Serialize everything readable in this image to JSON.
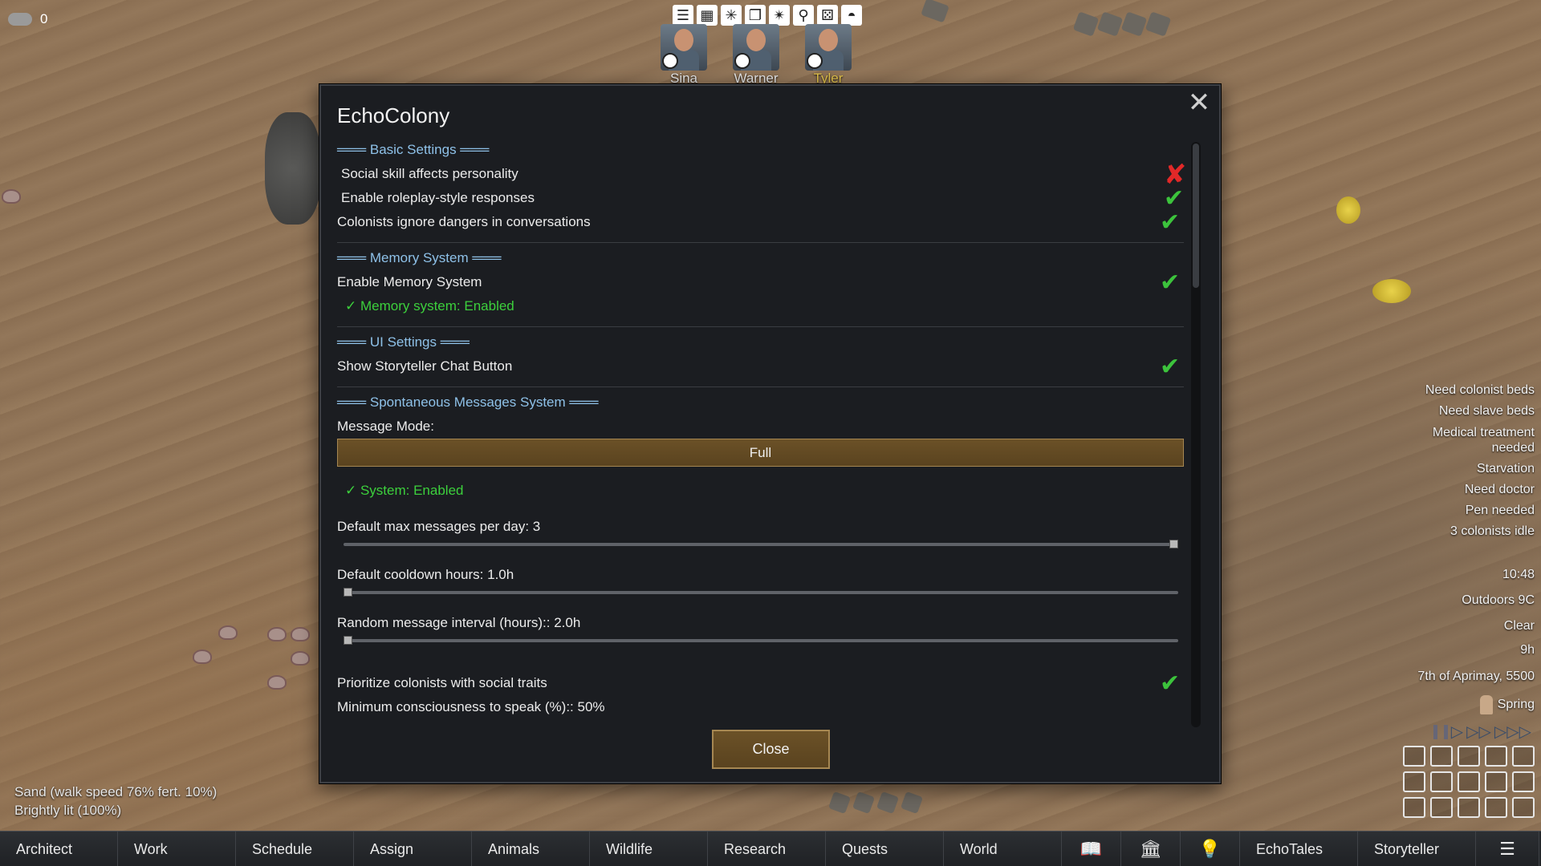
{
  "resource": {
    "count": "0",
    "icon": "cloud-icon"
  },
  "top_toolbar": {
    "icons": [
      "list-icon",
      "grid-icon",
      "sparkle-icon",
      "copy-icon",
      "sparkle-play-icon",
      "magnifier-icon",
      "dice-icon",
      "mask-icon"
    ]
  },
  "colonists": [
    {
      "name": "Sina",
      "selected": false
    },
    {
      "name": "Warner",
      "selected": false
    },
    {
      "name": "Tyler",
      "selected": true
    }
  ],
  "dialog": {
    "title": "EchoColony",
    "close_icon": "close-icon",
    "sections": {
      "basic": "═══ Basic Settings ═══",
      "memory": "═══ Memory System ═══",
      "ui": "═══ UI Settings ═══",
      "spontaneous": "═══ Spontaneous Messages System ═══"
    },
    "basic": {
      "social_skill": "Social skill affects personality",
      "roleplay": "Enable roleplay-style responses",
      "ignore_dangers": "Colonists ignore dangers in conversations"
    },
    "memory": {
      "enable": "Enable Memory System",
      "status": "✓ Memory system: Enabled"
    },
    "ui": {
      "storyteller_button": "Show Storyteller Chat Button"
    },
    "spontaneous": {
      "message_mode_label": "Message Mode:",
      "message_mode_value": "Full",
      "system_status": "✓ System: Enabled",
      "max_messages": "Default max messages per day: 3",
      "max_messages_value": 3,
      "max_messages_fraction": 1.0,
      "cooldown": "Default cooldown hours: 1.0h",
      "cooldown_fraction": 0.0,
      "random_interval": "Random message interval (hours):: 2.0h",
      "random_interval_fraction": 0.0,
      "prioritize_social": "Prioritize colonists with social traits",
      "min_consciousness": "Minimum consciousness to speak (%):: 50%"
    },
    "close_label": "Close",
    "toggles": {
      "social_skill": false,
      "roleplay": true,
      "ignore_dangers": true,
      "memory_enabled": true,
      "storyteller_button": true,
      "prioritize_social": true
    }
  },
  "alerts": [
    "Need colonist beds",
    "Need slave beds",
    "Medical treatment needed",
    "Starvation",
    "Need doctor",
    "Pen needed",
    "3 colonists idle"
  ],
  "status_info": {
    "time": "10:48",
    "temperature": "Outdoors 9C",
    "weather": "Clear",
    "hours": "9h",
    "date": "7th of Aprimay, 5500",
    "season": "Spring"
  },
  "speed_controls": {
    "pause_icon": "pause-icon",
    "play_icons": [
      "play-icon",
      "play-fast-icon",
      "play-superfast-icon"
    ]
  },
  "cell_info": {
    "terrain": "Sand (walk speed 76% fert. 10%)",
    "light": "Brightly lit (100%)"
  },
  "bottom_tabs": [
    "Architect",
    "Work",
    "Schedule",
    "Assign",
    "Animals",
    "Wildlife",
    "Research",
    "Quests",
    "World",
    "",
    "",
    "",
    "EchoTales",
    "Storyteller",
    ""
  ],
  "bottom_tab_icons": {
    "9": "book-icon",
    "10": "ideology-icon",
    "11": "lightbulb-icon",
    "14": "menu-icon"
  },
  "colors": {
    "check_ok": "#3cc33c",
    "check_off": "#e22828",
    "section": "#8ec1e8",
    "status_green": "#3cd03c",
    "button_brown": "#6b5127",
    "selected_name": "#e5c54d"
  }
}
